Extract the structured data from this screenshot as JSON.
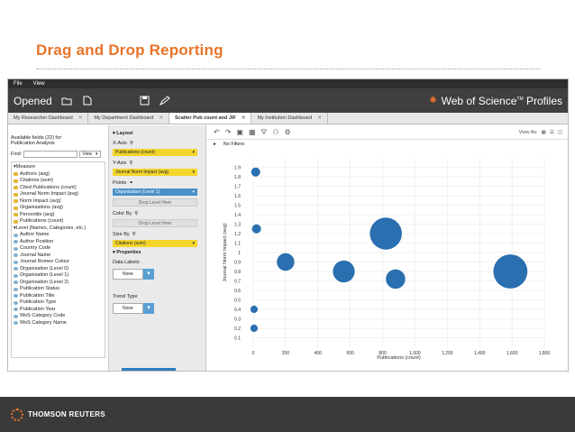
{
  "slide_title": "Drag and Drop Reporting",
  "menu": [
    "File",
    "View"
  ],
  "header": {
    "opened": "Opened",
    "brand": "Web of Science",
    "tm": "TM",
    "profiles": " Profiles"
  },
  "tabs": [
    {
      "label": "My Researcher Dashboard",
      "active": false
    },
    {
      "label": "My Department Dashboard",
      "active": false
    },
    {
      "label": "Scatter Pub count and JIF",
      "active": true
    },
    {
      "label": "My Institution Dashboard",
      "active": false
    }
  ],
  "fields_panel": {
    "available": "Available fields (22) for:",
    "source": "Publication Analysis",
    "find_label": "Find:",
    "view_label": "View",
    "measure_group": "Measure",
    "measures": [
      "Authors (avg)",
      "Citations (sum)",
      "Cited Publications (count)",
      "Journal Norm Impact (avg)",
      "Norm Impact (avg)",
      "Organisations (avg)",
      "Percentile (avg)",
      "Publications (count)"
    ],
    "level_group": "Level (Names, Categories, etc.)",
    "levels": [
      "Author Name",
      "Author Position",
      "Country Code",
      "Journal Name",
      "Journal Romeo Colour",
      "Organisation (Level 0)",
      "Organisation (Level 1)",
      "Organisation (Level 2)",
      "Publication Status",
      "Publication Title",
      "Publication Type",
      "Publication Year",
      "WoS Category Code",
      "WoS Category Name"
    ]
  },
  "config": {
    "layout": "Layout",
    "xaxis_label": "X-Axis",
    "xaxis_value": "Publications (count)",
    "yaxis_label": "Y-Axis",
    "yaxis_value": "Journal Norm Impact (avg)",
    "points_label": "Points",
    "points_value": "Organisation (Level 1)",
    "drop": "Drop Level Here",
    "colorby_label": "Color By",
    "sizeby_label": "Size By",
    "sizeby_value": "Citations (sum)",
    "properties": "Properties",
    "datalabels_label": "Data Labels:",
    "datalabels_value": "None",
    "trend_label": "Trend Type",
    "trend_value": "None"
  },
  "chart_toolbar": {
    "view_as": "View As:",
    "filters": "No Filters"
  },
  "chart_data": {
    "type": "scatter",
    "xlabel": "Publications (count)",
    "ylabel": "Journal Norm Impact (avg)",
    "xlim": [
      0,
      1800
    ],
    "ylim": [
      0,
      2.0
    ],
    "xticks": [
      0,
      200,
      400,
      600,
      800,
      1000,
      1200,
      1400,
      1600,
      1800
    ],
    "xtick_labels": [
      "0",
      "200",
      "400",
      "600",
      "800",
      "1,000",
      "1,200",
      "1,400",
      "1,600",
      "1,800"
    ],
    "yticks": [
      0.1,
      0.2,
      0.3,
      0.4,
      0.5,
      0.6,
      0.7,
      0.8,
      0.9,
      1.0,
      1.1,
      1.2,
      1.3,
      1.4,
      1.5,
      1.6,
      1.7,
      1.8,
      1.9
    ],
    "ytick_labels": [
      "0.1",
      "0.2",
      "0.3",
      "0.4",
      "0.5",
      "0.6",
      "0.7",
      "0.8",
      "0.9",
      "1",
      "1.1",
      "1.2",
      "1.3",
      "1.4",
      "1.5",
      "1.6",
      "1.7",
      "1.8",
      "1.9"
    ],
    "grid": true,
    "color": "#2a6fb0",
    "points": [
      {
        "x": 15,
        "y": 1.85,
        "size": 12
      },
      {
        "x": 20,
        "y": 1.25,
        "size": 12
      },
      {
        "x": 5,
        "y": 0.4,
        "size": 8
      },
      {
        "x": 5,
        "y": 0.2,
        "size": 8
      },
      {
        "x": 200,
        "y": 0.9,
        "size": 45
      },
      {
        "x": 560,
        "y": 0.8,
        "size": 70
      },
      {
        "x": 820,
        "y": 1.2,
        "size": 150
      },
      {
        "x": 880,
        "y": 0.72,
        "size": 55
      },
      {
        "x": 1590,
        "y": 0.8,
        "size": 170
      }
    ]
  },
  "footer": {
    "company": "THOMSON REUTERS"
  },
  "colors": {
    "accent": "#e8742a",
    "header": "#3f3f3f",
    "bubble": "#2a6fb0",
    "pill_yellow": "#f3d52c",
    "pill_blue": "#4a91c7"
  }
}
